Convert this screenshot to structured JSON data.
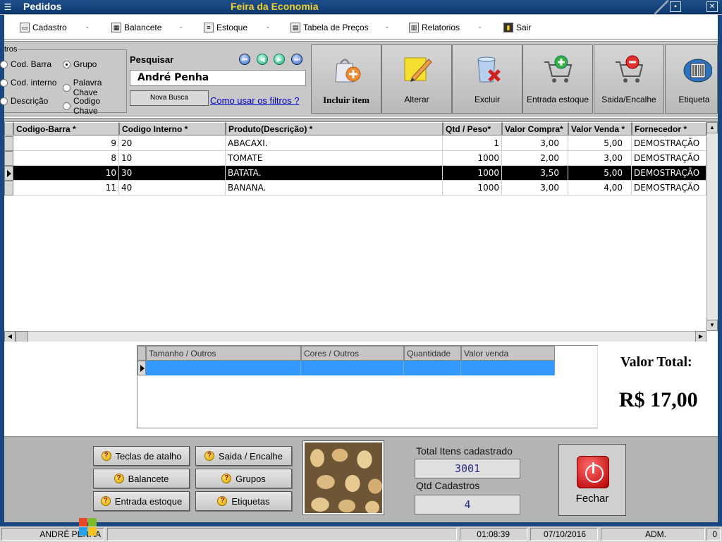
{
  "window": {
    "title": "Pedidos",
    "center_title": "Feira da Economia"
  },
  "menu": {
    "items": [
      {
        "label": "Cadastro"
      },
      {
        "label": "Balancete"
      },
      {
        "label": "Estoque"
      },
      {
        "label": "Tabela de Preços"
      },
      {
        "label": "Relatorios"
      },
      {
        "label": "Sair"
      }
    ],
    "separator": "-"
  },
  "filters": {
    "legend": "tros",
    "options": [
      {
        "label": "Cod. Barra",
        "checked": false
      },
      {
        "label": "Grupo",
        "checked": true
      },
      {
        "label": "Cod. interno",
        "checked": false
      },
      {
        "label": "Palavra Chave",
        "checked": false
      },
      {
        "label": "Descrição",
        "checked": false
      },
      {
        "label": "Codigo Chave",
        "checked": false
      }
    ]
  },
  "search": {
    "label": "Pesquisar",
    "value": "André Penha",
    "new_search": "Nova Busca",
    "help_link": "Como usar os filtros ?"
  },
  "toolbar": {
    "incluir": "Incluir item",
    "alterar": "Alterar",
    "excluir": "Excluir",
    "entrada": "Entrada estoque",
    "saida": "Saida/Encalhe",
    "etiqueta": "Etiqueta"
  },
  "grid": {
    "columns": [
      "Codigo-Barra  *",
      "Codigo Interno *",
      "Produto(Descrição)   *",
      "Qtd / Peso*",
      "Valor Compra*",
      "Valor Venda *",
      "Fornecedor   *"
    ],
    "rows": [
      [
        "9",
        "20",
        "ABACAXI.",
        "1",
        "3,00",
        "5,00",
        "DEMOSTRAÇÃO"
      ],
      [
        "8",
        "10",
        "TOMATE",
        "1000",
        "2,00",
        "3,00",
        "DEMOSTRAÇÃO"
      ],
      [
        "10",
        "30",
        "BATATA.",
        "1000",
        "3,50",
        "5,00",
        "DEMOSTRAÇÃO"
      ],
      [
        "11",
        "40",
        "BANANA.",
        "1000",
        "3,00",
        "4,00",
        "DEMOSTRAÇÃO"
      ]
    ],
    "selected_row": 2
  },
  "subgrid": {
    "columns": [
      "Tamanho / Outros",
      "Cores / Outros",
      "Quantidade",
      "Valor venda"
    ]
  },
  "totals": {
    "valor_total_label": "Valor Total:",
    "valor_total": "R$ 17,00",
    "itens_label": "Total Itens cadastrado",
    "itens_value": "3001",
    "qtd_label": "Qtd Cadastros",
    "qtd_value": "4"
  },
  "shortcuts": {
    "teclas": "Teclas de atalho",
    "saida": "Saida / Encalhe",
    "balancete": "Balancete",
    "grupos": "Grupos",
    "entrada": "Entrada estoque",
    "etiquetas": "Etiquetas"
  },
  "fechar": "Fechar",
  "status": {
    "user": "ANDRÉ PENHA",
    "time": "01:08:39",
    "date": "07/10/2016",
    "role": "ADM.",
    "count": "0"
  },
  "colors": {
    "frame": "#1a477f",
    "title_accent": "#f0d030",
    "selection": "#3399ff",
    "link": "#0000cc"
  }
}
